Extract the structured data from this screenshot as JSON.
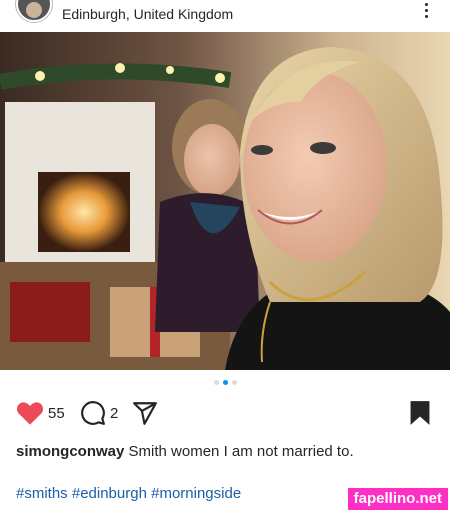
{
  "header": {
    "location": "Edinburgh, United Kingdom",
    "more_icon": "more-vertical-icon"
  },
  "carousel": {
    "total": 3,
    "active": 2
  },
  "actions": {
    "likes": "55",
    "comments": "2",
    "icons": [
      "heart-icon",
      "comment-icon",
      "share-icon",
      "bookmark-icon"
    ],
    "like_color": "#ed4956"
  },
  "caption": {
    "username": "simongconway",
    "text": "Smith women I am not married to.",
    "hashtags": [
      "#smiths",
      "#edinburgh",
      "#morningside"
    ]
  },
  "watermark": "fapellino.net",
  "colors": {
    "accent": "#0095f6",
    "hashtag": "#1b5fa8",
    "watermark_bg": "#ff2ec4"
  }
}
